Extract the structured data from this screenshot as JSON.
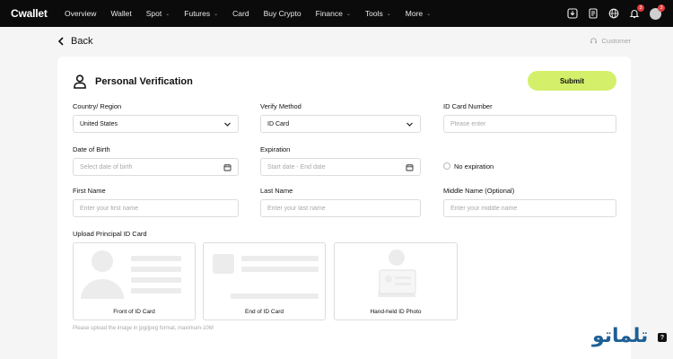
{
  "nav": {
    "logo": "Cwallet",
    "items": [
      {
        "label": "Overview",
        "caret": false
      },
      {
        "label": "Wallet",
        "caret": false
      },
      {
        "label": "Spot",
        "caret": true
      },
      {
        "label": "Futures",
        "caret": true
      },
      {
        "label": "Card",
        "caret": false
      },
      {
        "label": "Buy Crypto",
        "caret": false
      },
      {
        "label": "Finance",
        "caret": true
      },
      {
        "label": "Tools",
        "caret": true
      },
      {
        "label": "More",
        "caret": true
      }
    ],
    "caret_glyph": "⌄",
    "icons": [
      "download-icon",
      "orders-icon",
      "globe-icon",
      "bell-icon",
      "avatar"
    ],
    "notification_count": "3",
    "avatar_count": "3"
  },
  "back_label": "Back",
  "customer_label": "Customer",
  "page_title": "Personal Verification",
  "submit_label": "Submit",
  "form": {
    "country_label": "Country/ Region",
    "country_value": "United States",
    "method_label": "Verify Method",
    "method_value": "ID Card",
    "idnum_label": "ID Card Number",
    "idnum_placeholder": "Please enter",
    "dob_label": "Date of Birth",
    "dob_placeholder": "Select date of birth",
    "exp_label": "Expiration",
    "exp_placeholder": "Start date - End date",
    "no_exp_label": "No expiration",
    "first_label": "First Name",
    "first_placeholder": "Enter your first name",
    "last_label": "Last Name",
    "last_placeholder": "Enter your last name",
    "middle_label": "Middle Name (Optional)",
    "middle_placeholder": "Enter your middle name"
  },
  "upload": {
    "title": "Upload Principal ID Card",
    "front_caption": "Front of ID Card",
    "end_caption": "End of ID Card",
    "handheld_caption": "Hand-held ID Photo",
    "hint": "Please upload the image in jpg/jpeg format, maximum-10M"
  },
  "watermark": "تلماتو",
  "help_glyph": "?",
  "colors": {
    "accent": "#d4f06a",
    "topbar": "#0b0b0b",
    "badge": "#e23b3b",
    "watermark": "#1e5f94"
  }
}
